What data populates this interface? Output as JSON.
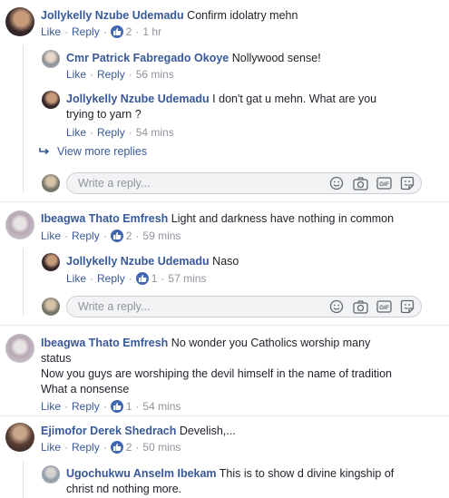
{
  "actions": {
    "like": "Like",
    "reply": "Reply",
    "dot": "·"
  },
  "comments": [
    {
      "name": "Jollykelly Nzube Udemadu",
      "text": "Confirm idolatry mehn",
      "likes": "2",
      "time": "1 hr"
    },
    {
      "name": "Ibeagwa Thato Emfresh",
      "text": "Light and darkness have nothing in common",
      "likes": "2",
      "time": "59 mins"
    },
    {
      "name": "Ibeagwa Thato Emfresh",
      "text_lines": [
        "No wonder you Catholics worship many",
        "status",
        "Now you guys are worshiping the devil himself in the name of tradition",
        "What a nonsense"
      ],
      "likes": "1",
      "time": "54 mins"
    },
    {
      "name": "Ejimofor Derek Shedrach",
      "text": "Develish,...",
      "likes": "2",
      "time": "50 mins"
    }
  ],
  "replies": [
    {
      "name": "Cmr Patrick Fabregado Okoye",
      "text": "Nollywood sense!",
      "time": "56 mins"
    },
    {
      "name": "Jollykelly Nzube Udemadu",
      "text_lines": [
        "I don't gat u mehn. What are you",
        "trying to yarn ?"
      ],
      "time": "54 mins"
    },
    {
      "name": "Jollykelly Nzube Udemadu",
      "text": "Naso",
      "likes": "1",
      "time": "57 mins"
    },
    {
      "name": "Ugochukwu Anselm Ibekam",
      "text_lines": [
        "This is to show d divine kingship of",
        "christ nd nothing more."
      ]
    }
  ],
  "view_more": "View more replies",
  "reply_placeholder": "Write a reply...",
  "reply_icons": [
    "emoji-icon",
    "camera-icon",
    "gif-icon",
    "sticker-icon"
  ],
  "colors": {
    "link": "#385898",
    "like": "#4267b2",
    "muted": "#90949c"
  }
}
